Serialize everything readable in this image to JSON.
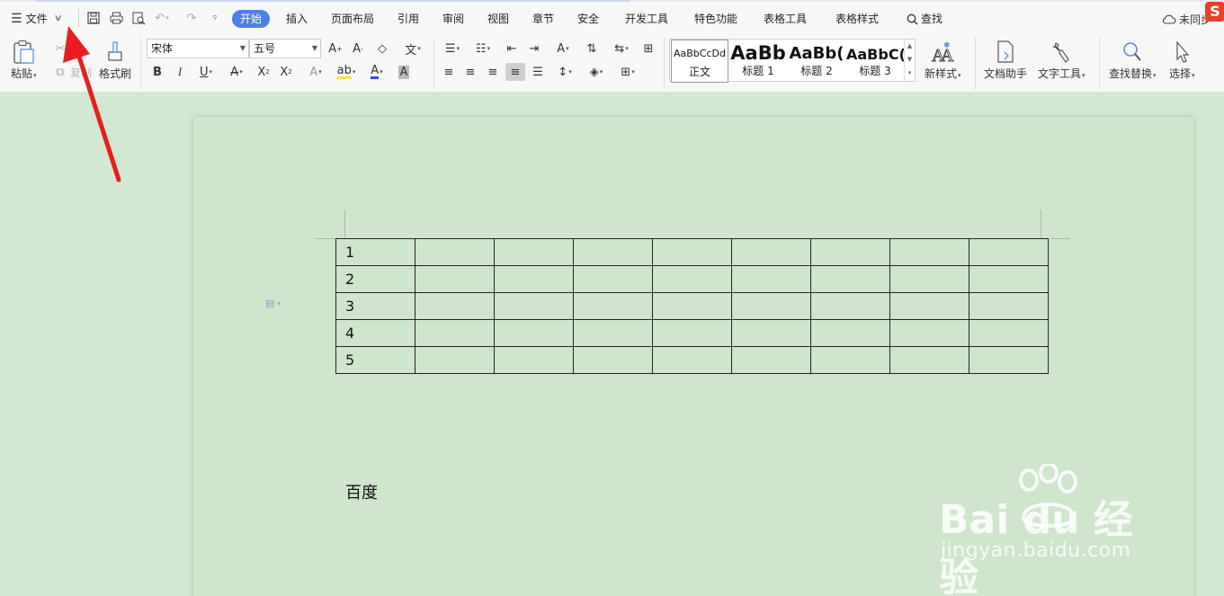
{
  "menubar": {
    "file_label": "文件",
    "tabs": [
      "开始",
      "插入",
      "页面布局",
      "引用",
      "审阅",
      "视图",
      "章节",
      "安全",
      "开发工具",
      "特色功能",
      "表格工具",
      "表格样式"
    ],
    "active_tab": "开始",
    "search_label": "查找",
    "sync_label": "未同步"
  },
  "ribbon": {
    "paste_label": "粘贴",
    "cut_label": "剪切",
    "copy_label": "复制",
    "format_painter_label": "格式刷",
    "font_name": "宋体",
    "font_size": "五号",
    "styles": [
      {
        "preview": "AaBbCcDd",
        "name": "正文"
      },
      {
        "preview": "AaBb",
        "name": "标题 1"
      },
      {
        "preview": "AaBb(",
        "name": "标题 2"
      },
      {
        "preview": "AaBbC(",
        "name": "标题 3"
      }
    ],
    "new_style_label": "新样式",
    "doc_helper_label": "文档助手",
    "text_tools_label": "文字工具",
    "find_replace_label": "查找替换",
    "select_label": "选择"
  },
  "document": {
    "table_rows": [
      [
        "1",
        "",
        "",
        "",
        "",
        "",
        "",
        "",
        ""
      ],
      [
        "2",
        "",
        "",
        "",
        "",
        "",
        "",
        "",
        ""
      ],
      [
        "3",
        "",
        "",
        "",
        "",
        "",
        "",
        "",
        ""
      ],
      [
        "4",
        "",
        "",
        "",
        "",
        "",
        "",
        "",
        ""
      ],
      [
        "5",
        "",
        "",
        "",
        "",
        "",
        "",
        "",
        ""
      ]
    ],
    "paragraph": "百度"
  },
  "watermark": {
    "brand": "Bai du 经验",
    "url": "jingyan.baidu.com"
  },
  "colors": {
    "accent": "#4f7fe8",
    "page_bg": "#cfe6cd",
    "arrow": "#e81d1d"
  }
}
